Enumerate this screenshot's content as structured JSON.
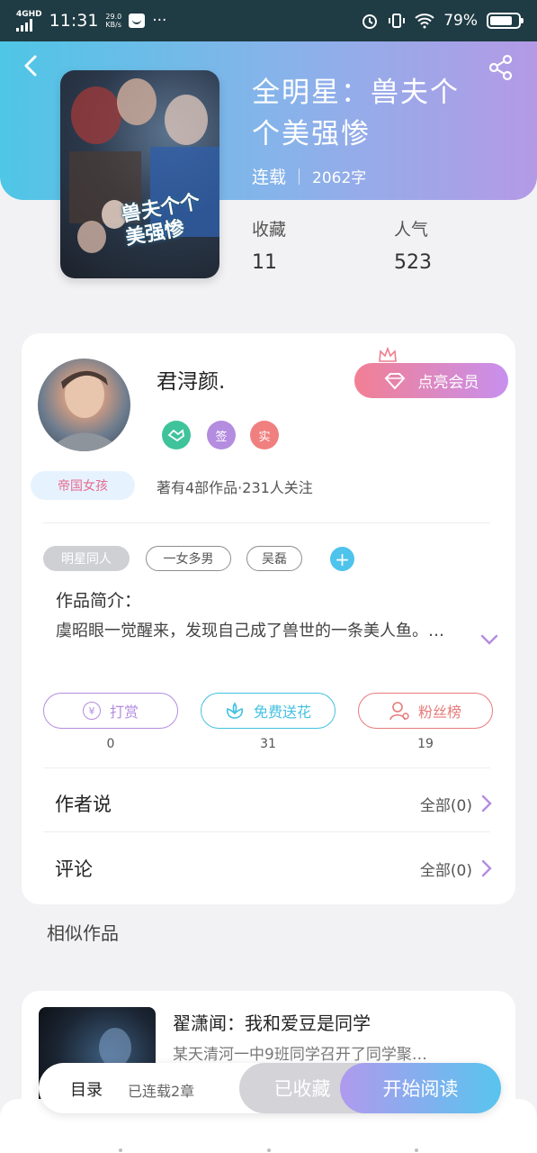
{
  "status_bar": {
    "network": "4GHD",
    "time": "11:31",
    "speed_value": "29.0",
    "speed_unit": "KB/s",
    "more": "···",
    "battery": "79%"
  },
  "book": {
    "title": "全明星：兽夫个个美强惨",
    "status": "连载",
    "word_count": "2062字",
    "cover_text": "兽夫个个美强惨",
    "stats": {
      "favorites_label": "收藏",
      "favorites_value": "11",
      "popularity_label": "人气",
      "popularity_value": "523"
    }
  },
  "author": {
    "name": "君浔颜.",
    "badge_label": "帝国女孩",
    "vip_button": "点亮会员",
    "badges": [
      "签",
      "实"
    ],
    "stats_text": "著有4部作品·231人关注"
  },
  "tags": [
    "明星同人",
    "一女多男",
    "吴磊"
  ],
  "add_tag": "+",
  "intro": {
    "heading": "作品简介：",
    "text": "虞昭眼一觉醒来，发现自己成了兽世的一条美人鱼。…"
  },
  "actions": {
    "tip": {
      "icon": "¥",
      "label": "打赏",
      "count": "0"
    },
    "flower": {
      "label": "免费送花",
      "count": "31"
    },
    "fans": {
      "label": "粉丝榜",
      "count": "19"
    }
  },
  "rows": {
    "author_says": {
      "title": "作者说",
      "right": "全部(0)"
    },
    "comments": {
      "title": "评论",
      "right": "全部(0)"
    }
  },
  "similar": {
    "heading": "相似作品",
    "items": [
      {
        "title": "翟潇闻：我和爱豆是同学",
        "desc": "某天清河一中9班同学召开了同学聚…"
      }
    ]
  },
  "bottom_bar": {
    "toc": "目录",
    "chapters": "已连载2章",
    "favorited": "已收藏",
    "start_reading": "开始阅读"
  },
  "colors": {
    "header_gradient": [
      "#4fc6e6",
      "#b49ae6"
    ],
    "vip_gradient": [
      "#f27f93",
      "#c790ee"
    ],
    "tip_color": "#b48ce0",
    "flower_color": "#43c1e0",
    "fans_color": "#e87a7a"
  }
}
